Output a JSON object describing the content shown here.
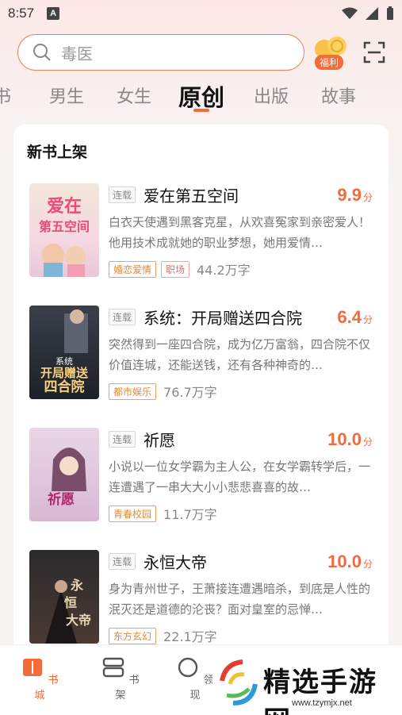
{
  "status": {
    "time": "8:57"
  },
  "search": {
    "placeholder": "毒医"
  },
  "welfare": {
    "badge": "福利"
  },
  "tabs": [
    {
      "label": "书"
    },
    {
      "label": "男生"
    },
    {
      "label": "女生"
    },
    {
      "label": "原创"
    },
    {
      "label": "出版"
    },
    {
      "label": "故事"
    }
  ],
  "section": {
    "title": "新书上架"
  },
  "books": [
    {
      "cover_label": "爱在第五空间",
      "serial": "连载",
      "title": "爱在第五空间",
      "score": "9.9",
      "unit": "分",
      "desc": "白衣天使遇到黑客克星，从欢喜冤家到亲密爱人！他用技术成就她的职业梦想，她用爱情…",
      "tags": [
        "婚恋爱情",
        "职场"
      ],
      "words": "44.2万字"
    },
    {
      "cover_label": "开局赠送四合院",
      "serial": "连载",
      "title": "系统：开局赠送四合院",
      "score": "6.4",
      "unit": "分",
      "desc": "突然得到一座四合院，成为亿万富翁，四合院不仅价值连城，还能送钱，还有各种神奇的…",
      "tags": [
        "都市娱乐"
      ],
      "words": "76.7万字"
    },
    {
      "cover_label": "祈愿",
      "serial": "连载",
      "title": "祈愿",
      "score": "10.0",
      "unit": "分",
      "desc": "小说以一位女学霸为主人公，在女学霸转学后，一连遭遇了一串大大小小悲悲喜喜的故…",
      "tags": [
        "青春校园"
      ],
      "words": "11.7万字"
    },
    {
      "cover_label": "永恒大帝",
      "serial": "连载",
      "title": "永恒大帝",
      "score": "10.0",
      "unit": "分",
      "desc": "身为青州世子，王萧接连遭遇暗杀，到底是人性的泯灭还是道德的沦丧？面对皇室的忌惮…",
      "tags": [
        "东方玄幻"
      ],
      "words": "22.1万字"
    }
  ],
  "nav": [
    {
      "label": "书城"
    },
    {
      "label": "书架"
    },
    {
      "label": "领现"
    }
  ],
  "watermark": {
    "text": "精选手游网",
    "url": "www.tzymjx.net"
  },
  "colors": {
    "accent": "#f36a3b",
    "tag_orange": "#e58937",
    "tag_pink": "#e46b6b"
  }
}
